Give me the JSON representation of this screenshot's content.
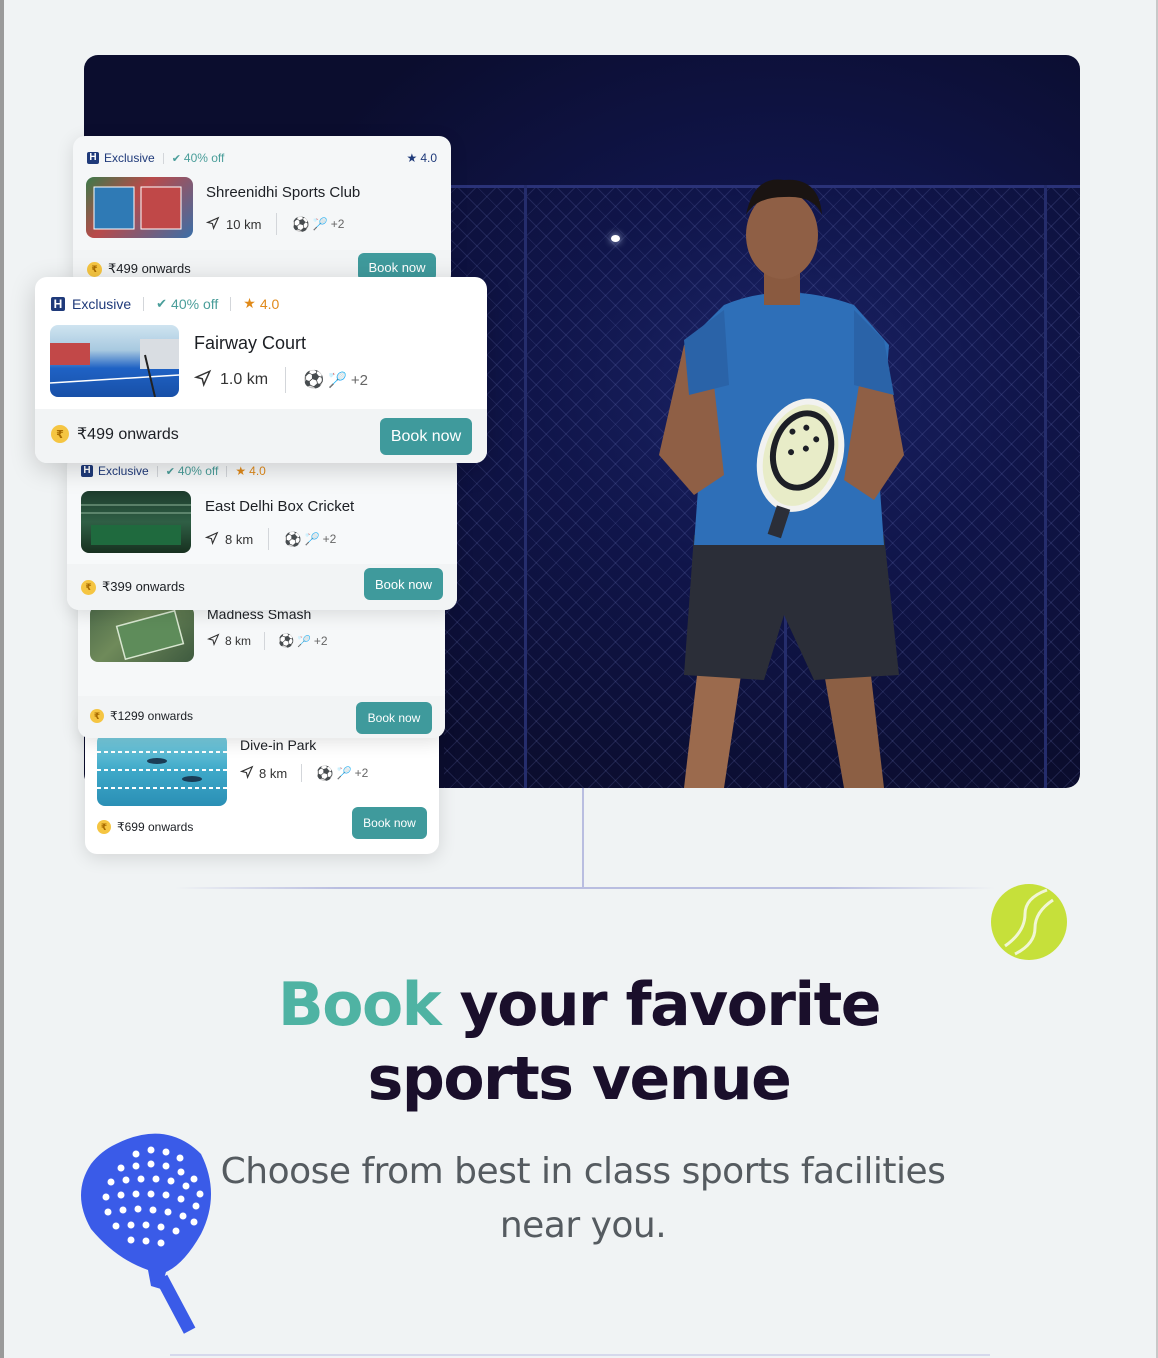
{
  "cards": [
    {
      "exclusive_label": "Exclusive",
      "discount": "40% off",
      "rating": "4.0",
      "name": "Shreenidhi Sports Club",
      "distance": "10 km",
      "extra_sports": "+2",
      "price": "₹499 onwards",
      "book_label": "Book now"
    },
    {
      "exclusive_label": "Exclusive",
      "discount": "40% off",
      "rating": "4.0",
      "name": "Fairway Court",
      "distance": "1.0 km",
      "extra_sports": "+2",
      "price": "₹499 onwards",
      "book_label": "Book now"
    },
    {
      "exclusive_label": "Exclusive",
      "discount": "40% off",
      "rating": "4.0",
      "name": "East Delhi Box Cricket",
      "distance": "8 km",
      "extra_sports": "+2",
      "price": "₹399 onwards",
      "book_label": "Book now"
    },
    {
      "name": "Madness Smash",
      "distance": "8 km",
      "extra_sports": "+2",
      "price": "₹1299 onwards",
      "book_label": "Book now"
    },
    {
      "name": "Dive-in Park",
      "distance": "8 km",
      "extra_sports": "+2",
      "price": "₹699 onwards",
      "book_label": "Book now"
    }
  ],
  "headline": {
    "accent_word": "Book",
    "rest_line1": "your favorite",
    "line2": "sports venue"
  },
  "subtitle": "Choose from best in class sports facilities near you.",
  "colors": {
    "accent": "#4fb3a3",
    "button": "#3f9a9c",
    "headline": "#1a0f2b",
    "ball": "#c6e03a",
    "racket": "#3a5be8"
  },
  "icons": [
    "navigation-icon",
    "football-icon",
    "racket-icon",
    "rupee-coin-icon",
    "star-icon",
    "verified-icon",
    "hotel-h-icon",
    "tennis-ball-icon",
    "padel-racket-icon"
  ]
}
